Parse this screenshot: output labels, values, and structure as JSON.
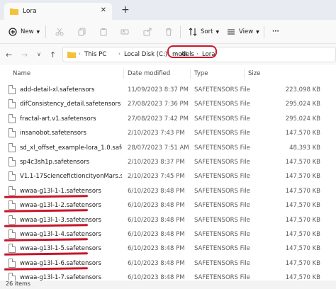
{
  "window": {
    "tab_title": "Lora",
    "tab_close": "✕",
    "tab_new": "+"
  },
  "toolbar": {
    "new_label": "New",
    "sort_label": "Sort",
    "view_label": "View",
    "more_label": "···"
  },
  "nav": {
    "back": "←",
    "forward": "→",
    "down": "∨",
    "up": "↑"
  },
  "breadcrumbs": [
    "This PC",
    "Local Disk (C:)",
    "AI",
    "models",
    "Lora"
  ],
  "columns": {
    "name": "Name",
    "date": "Date modified",
    "type": "Type",
    "size": "Size"
  },
  "files": [
    {
      "name": "add-detail-xl.safetensors",
      "date": "11/09/2023 8:37 PM",
      "type": "SAFETENSORS File",
      "size": "223,098 KB",
      "marked": false
    },
    {
      "name": "difConsistency_detail.safetensors",
      "date": "27/08/2023 7:36 PM",
      "type": "SAFETENSORS File",
      "size": "295,024 KB",
      "marked": false
    },
    {
      "name": "fractal-art.v1.safetensors",
      "date": "27/08/2023 7:42 PM",
      "type": "SAFETENSORS File",
      "size": "295,024 KB",
      "marked": false
    },
    {
      "name": "insanobot.safetensors",
      "date": "2/10/2023 7:43 PM",
      "type": "SAFETENSORS File",
      "size": "147,570 KB",
      "marked": false
    },
    {
      "name": "sd_xl_offset_example-lora_1.0.safetensors",
      "date": "28/07/2023 7:51 AM",
      "type": "SAFETENSORS File",
      "size": "48,393 KB",
      "marked": false
    },
    {
      "name": "sp4c3sh1p.safetensors",
      "date": "2/10/2023 8:37 PM",
      "type": "SAFETENSORS File",
      "size": "147,570 KB",
      "marked": false
    },
    {
      "name": "V1.1-17SciencefictioncityonMars.safeten...",
      "date": "2/10/2023 7:45 PM",
      "type": "SAFETENSORS File",
      "size": "147,570 KB",
      "marked": false
    },
    {
      "name": "wwaa-g13l-1-1.safetensors",
      "date": "6/10/2023 8:48 PM",
      "type": "SAFETENSORS File",
      "size": "147,570 KB",
      "marked": true
    },
    {
      "name": "wwaa-g13l-1-2.safetensors",
      "date": "6/10/2023 8:48 PM",
      "type": "SAFETENSORS File",
      "size": "147,570 KB",
      "marked": true
    },
    {
      "name": "wwaa-g13l-1-3.safetensors",
      "date": "6/10/2023 8:48 PM",
      "type": "SAFETENSORS File",
      "size": "147,570 KB",
      "marked": true
    },
    {
      "name": "wwaa-g13l-1-4.safetensors",
      "date": "6/10/2023 8:48 PM",
      "type": "SAFETENSORS File",
      "size": "147,570 KB",
      "marked": true
    },
    {
      "name": "wwaa-g13l-1-5.safetensors",
      "date": "6/10/2023 8:48 PM",
      "type": "SAFETENSORS File",
      "size": "147,570 KB",
      "marked": true
    },
    {
      "name": "wwaa-g13l-1-6.safetensors",
      "date": "6/10/2023 8:48 PM",
      "type": "SAFETENSORS File",
      "size": "147,570 KB",
      "marked": true
    },
    {
      "name": "wwaa-g13l-1-7.safetensors",
      "date": "6/10/2023 8:48 PM",
      "type": "SAFETENSORS File",
      "size": "147,570 KB",
      "marked": true
    }
  ],
  "status": {
    "item_count": "26 items"
  },
  "colors": {
    "annotation_red": "#d0182a",
    "folder_yellow": "#f3c13a"
  }
}
